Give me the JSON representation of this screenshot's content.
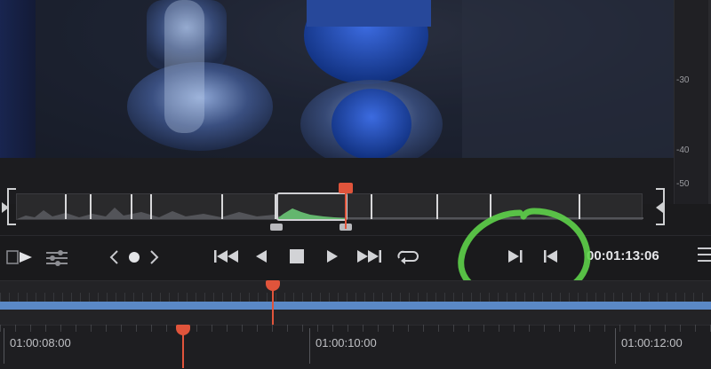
{
  "meter": {
    "ticks": [
      "-30",
      "-40",
      "-50"
    ]
  },
  "transport": {
    "timecode": "00:01:13:06",
    "icons": [
      "clip-view-icon",
      "settings-sliders-icon",
      "prev-edit-icon",
      "dot-icon",
      "next-edit-icon",
      "go-to-start-icon",
      "play-reverse-icon",
      "stop-icon",
      "play-icon",
      "go-to-end-icon",
      "loop-icon",
      "mark-in-icon",
      "mark-out-icon",
      "menu-icon"
    ]
  },
  "timeline": {
    "labels": [
      "01:00:08:00",
      "01:00:10:00",
      "01:00:12:00"
    ]
  },
  "colors": {
    "playhead": "#e0543b",
    "track": "#5a88c6",
    "annotation": "#5ed14a",
    "waveform": "#6fcf7a"
  }
}
